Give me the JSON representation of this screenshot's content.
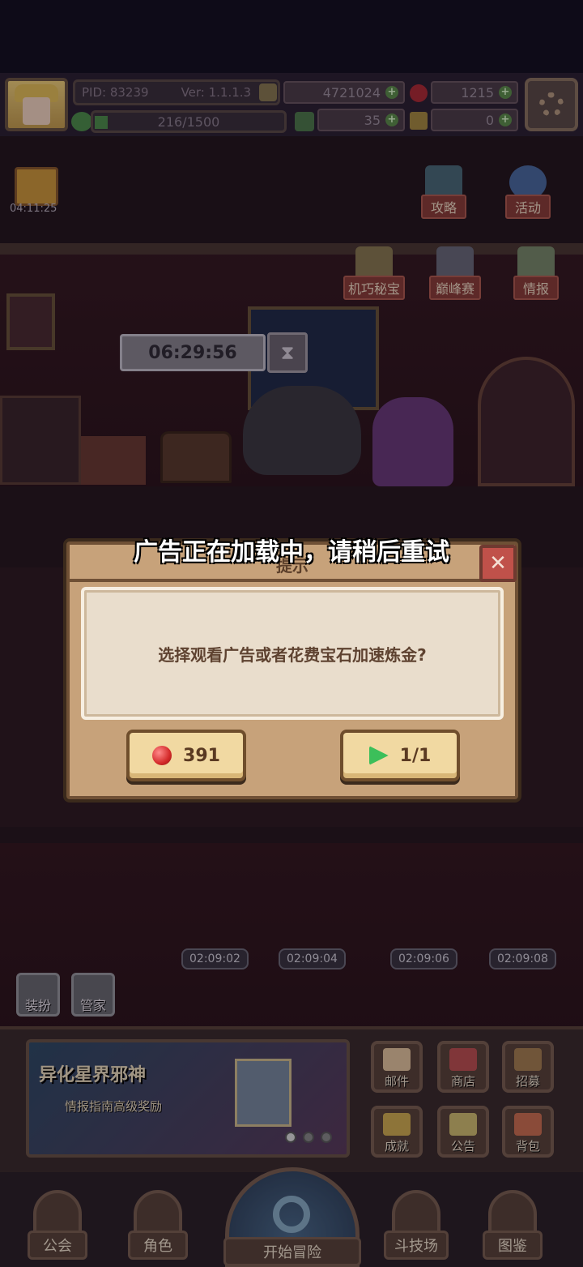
{
  "top_bar": {
    "pid": "PID: 83239",
    "version": "Ver: 1.1.1.3",
    "gold": "4721024",
    "gems": "1215",
    "exp": "216/1500",
    "clover": "35",
    "key_item": "0"
  },
  "gift_timer": "04:11:25",
  "side_buttons": {
    "guide": "攻略",
    "activity": "活动",
    "secret_treasure": "机巧秘宝",
    "peak_match": "巅峰赛",
    "intel": "情报"
  },
  "alchemy_timer": "06:29:56",
  "toast": "广告正在加载中，请稍后重试",
  "dialog": {
    "title": "提示",
    "message": "选择观看广告或者花费宝石加速炼金?",
    "gem_cost": "391",
    "ad_count": "1/1",
    "close": "✕"
  },
  "room_timers": [
    "02:09:02",
    "02:09:04",
    "02:09:06",
    "02:09:08"
  ],
  "room_buttons": {
    "dress": "装扮",
    "butler": "管家"
  },
  "event": {
    "title": "异化星界邪神",
    "subtitle": "情报指南高级奖励"
  },
  "grid_buttons": {
    "mail": "邮件",
    "shop": "商店",
    "recruit": "招募",
    "achievement": "成就",
    "notice": "公告",
    "backpack": "背包"
  },
  "nav": {
    "guild": "公会",
    "character": "角色",
    "start": "开始冒险",
    "arena": "斗技场",
    "codex": "图鉴"
  },
  "colors": {
    "accent": "#c0514a",
    "dialog_bg": "#c7a27a",
    "button_bg": "#f1d9a2"
  }
}
